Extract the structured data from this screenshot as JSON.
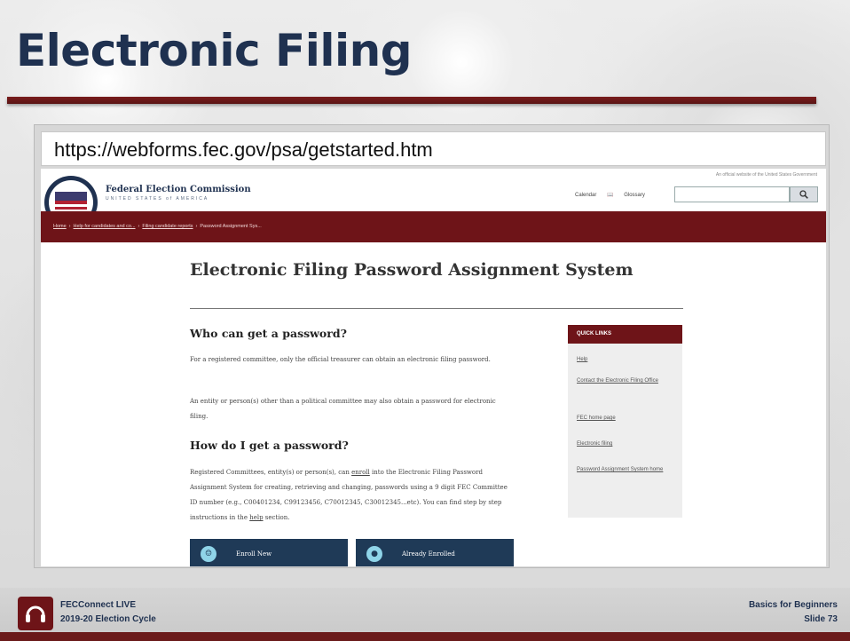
{
  "slide": {
    "title": "Electronic Filing",
    "url": "https://webforms.fec.gov/psa/getstarted.htm"
  },
  "site": {
    "official_banner": "An official website of the United States Government",
    "agency_name": "Federal Election Commission",
    "agency_subtitle": "UNITED STATES of AMERICA",
    "nav": {
      "calendar": "Calendar",
      "glossary": "Glossary"
    },
    "search": {
      "placeholder": ""
    },
    "breadcrumb": {
      "home": "Home",
      "crumb2": "Help for candidates and co...",
      "crumb3": "Filing candidate reports",
      "current": "Password Assignment Sys..."
    }
  },
  "content": {
    "heading": "Electronic Filing Password Assignment System",
    "section1_title": "Who can get a password?",
    "section1_p1": "For a registered committee, only the official treasurer can obtain an electronic filing password.",
    "section1_p2": "An entity or person(s) other than a political committee may also obtain a password for electronic filing.",
    "section2_title": "How do I get a password?",
    "section2_p_part1": "Registered Committees, entity(s) or person(s), can ",
    "section2_p_link1": "enroll",
    "section2_p_part2": " into the Electronic Filing Password Assignment System for creating, retrieving and changing, passwords using a 9 digit FEC Committee ID number (e.g., C00401234, C99123456, C70012345, C30012345...etc). You can find step by step instructions in the ",
    "section2_p_link2": "help",
    "section2_p_part3": " section.",
    "buttons": {
      "enroll": "Enroll New",
      "already": "Already Enrolled"
    }
  },
  "quick_links": {
    "header": "QUICK LINKS",
    "items": [
      "Help",
      "Contact the Electronic Filing Office",
      "FEC home page",
      "Electronic filing",
      "Password Assignment System home"
    ]
  },
  "footer": {
    "left_line1": "FECConnect LIVE",
    "left_line2": "2019-20 Election Cycle",
    "right_line1": "Basics for Beginners",
    "right_line2": "Slide 73"
  },
  "colors": {
    "maroon": "#6e1418",
    "navy": "#1f3150",
    "button": "#1f3a57"
  }
}
